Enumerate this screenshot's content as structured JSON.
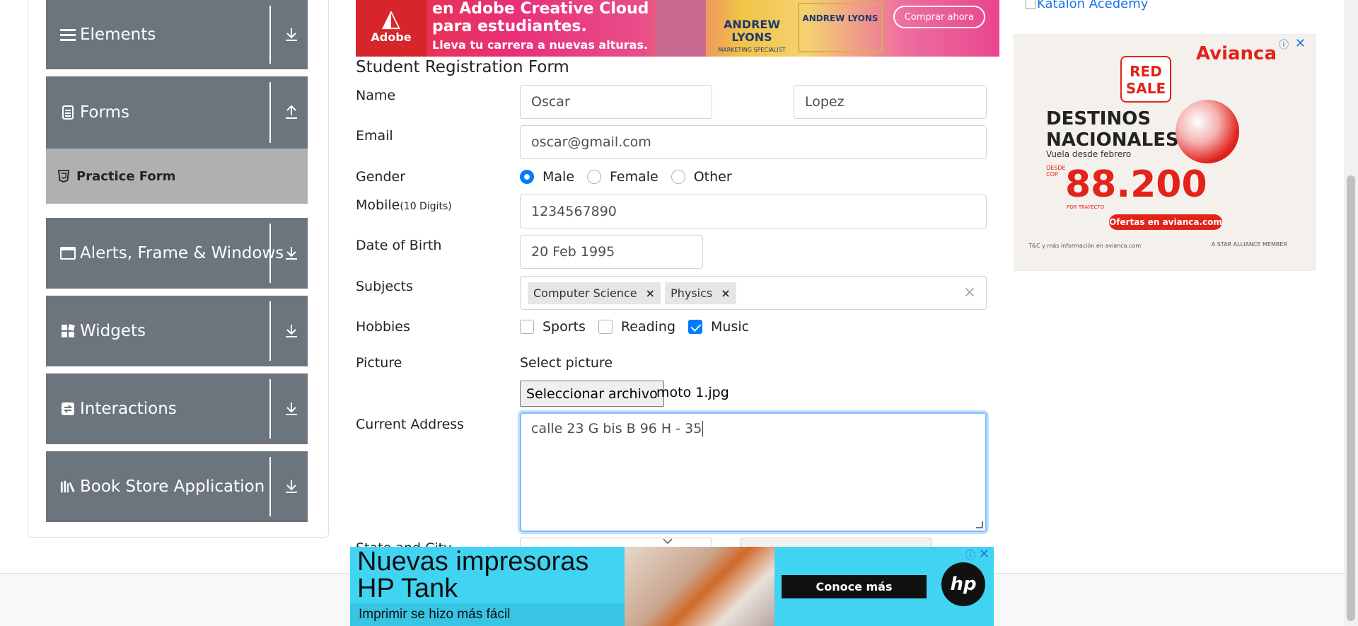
{
  "sidebar": {
    "groups": [
      {
        "label": "Elements",
        "icon": "list-icon",
        "arrow": "download-arrow-icon"
      },
      {
        "label": "Forms",
        "icon": "document-icon",
        "arrow": "upload-arrow-icon"
      },
      {
        "label": "Alerts, Frame & Windows",
        "icon": "window-icon",
        "arrow": "download-arrow-icon"
      },
      {
        "label": "Widgets",
        "icon": "grid-icon",
        "arrow": "download-arrow-icon"
      },
      {
        "label": "Interactions",
        "icon": "swap-icon",
        "arrow": "download-arrow-icon"
      },
      {
        "label": "Book Store Application",
        "icon": "books-icon",
        "arrow": "download-arrow-icon"
      }
    ],
    "active_item": {
      "label": "Practice Form",
      "icon": "html5-icon"
    }
  },
  "top_ad": {
    "logo_text": "Adobe",
    "line1": "en Adobe Creative Cloud",
    "line2": "para estudiantes.",
    "line3": "Lleva tu carrera a nuevas alturas.",
    "card_name": "ANDREW LYONS",
    "card_role": "MARKETING SPECIALIST",
    "card2_name": "ANDREW LYONS",
    "cta": "Comprar ahora"
  },
  "form": {
    "title": "Student Registration Form",
    "labels": {
      "name": "Name",
      "email": "Email",
      "gender": "Gender",
      "mobile": "Mobile",
      "mobile_hint": "(10 Digits)",
      "dob": "Date of Birth",
      "subjects": "Subjects",
      "hobbies": "Hobbies",
      "picture": "Picture",
      "address": "Current Address",
      "state_city": "State and City"
    },
    "first_name": "Oscar",
    "last_name": "Lopez",
    "email": "oscar@gmail.com",
    "gender_options": [
      "Male",
      "Female",
      "Other"
    ],
    "gender_selected": "Male",
    "mobile": "1234567890",
    "dob": "20 Feb 1995",
    "subjects": [
      "Computer Science",
      "Physics"
    ],
    "hobbies": [
      {
        "label": "Sports",
        "checked": false
      },
      {
        "label": "Reading",
        "checked": false
      },
      {
        "label": "Music",
        "checked": true
      }
    ],
    "picture_label": "Select picture",
    "file_button": "Seleccionar archivo",
    "file_name": "moto 1.jpg",
    "address": "calle 23 G bis B 96 H - 35"
  },
  "right_ad": {
    "link_text": "Katalon Acedemy",
    "brand": "Avianca",
    "badge": "RED SALE",
    "headline1": "DESTINOS",
    "headline2": "NACIONALES",
    "subline": "Vuela desde febrero",
    "price": "88.200",
    "price_prefix": "DESDE COP",
    "price_suffix": "POR TRAYECTO",
    "cta": "Ofertas en avianca.com",
    "footer": "T&C y más información en avianca.com",
    "alliance": "A STAR ALLIANCE MEMBER"
  },
  "bottom_ad": {
    "headline_line1": "Nuevas impresoras",
    "headline_line2": "HP Tank",
    "tagline": "Imprimir se hizo más fácil",
    "cta": "Conoce más",
    "brand": "hp"
  },
  "colors": {
    "sidebar_bg": "#6c757d",
    "active_item_bg": "#b0b0b0",
    "accent": "#007bff",
    "avianca_red": "#e2231a",
    "hp_cyan": "#41d3f2"
  }
}
